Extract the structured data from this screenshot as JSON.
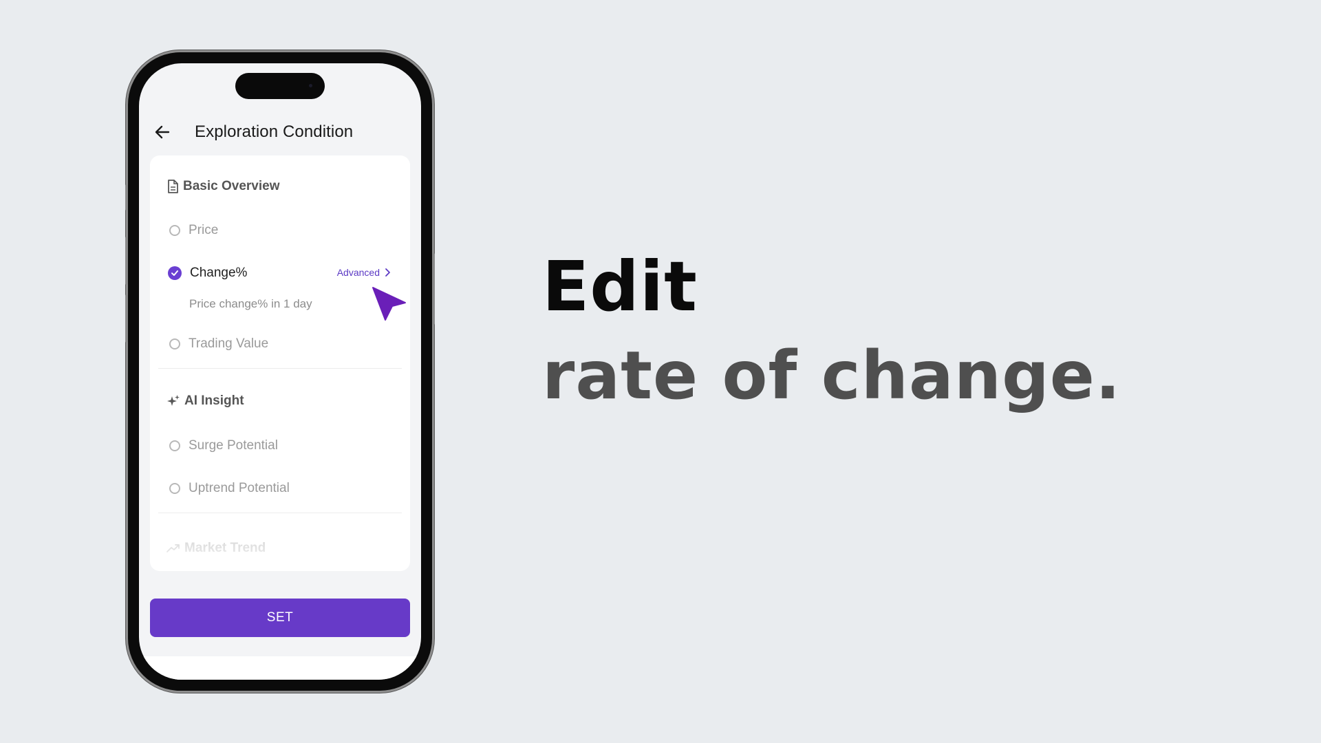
{
  "header": {
    "title": "Exploration Condition"
  },
  "sections": [
    {
      "icon": "document-icon",
      "title": "Basic Overview",
      "options": [
        {
          "label": "Price",
          "selected": false
        },
        {
          "label": "Change%",
          "selected": true,
          "description": "Price change% in 1 day",
          "link": "Advanced"
        },
        {
          "label": "Trading Value",
          "selected": false
        }
      ]
    },
    {
      "icon": "sparkle-icon",
      "title": "AI Insight",
      "options": [
        {
          "label": "Surge Potential",
          "selected": false
        },
        {
          "label": "Uptrend Potential",
          "selected": false
        }
      ]
    },
    {
      "icon": "trend-icon",
      "title": "Market Trend",
      "options": []
    }
  ],
  "footer": {
    "set_label": "SET"
  },
  "caption": {
    "line1": "Edit",
    "line2": "rate of change."
  },
  "colors": {
    "accent": "#673ac8",
    "background": "#e9ecef"
  }
}
